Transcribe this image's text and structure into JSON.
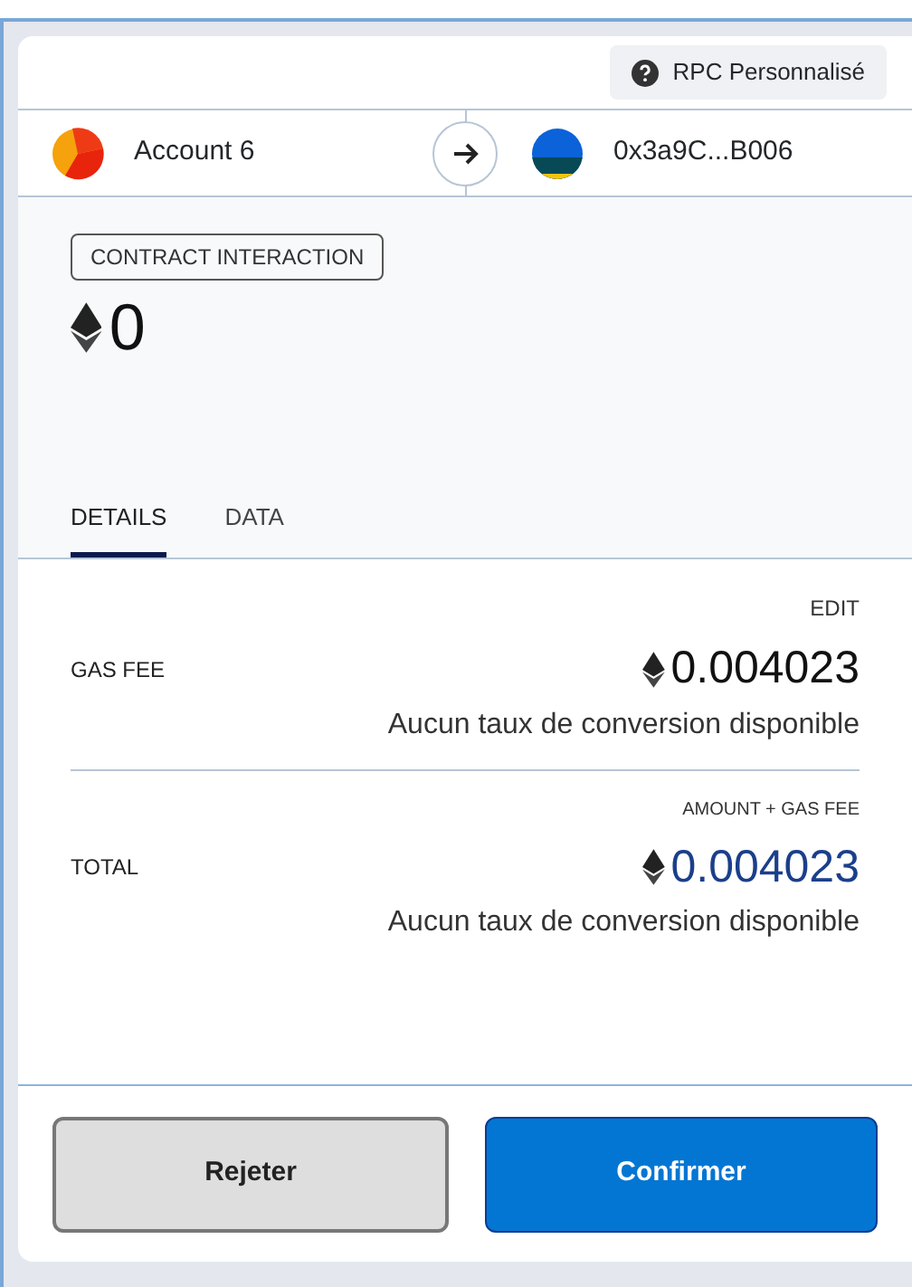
{
  "network": {
    "label": "RPC Personnalisé"
  },
  "from": {
    "name": "Account 6"
  },
  "to": {
    "address": "0x3a9C...B006"
  },
  "action": {
    "label": "CONTRACT INTERACTION"
  },
  "amount": "0",
  "tabs": [
    {
      "label": "DETAILS",
      "selected": true
    },
    {
      "label": "DATA",
      "selected": false
    }
  ],
  "rows": [
    {
      "heading": "EDIT",
      "label": "GAS FEE",
      "value": "0.004023",
      "conversion": "Aucun taux de conversion disponible",
      "highlight": false,
      "heading_link": true
    },
    {
      "heading": "AMOUNT + GAS FEE",
      "label": "TOTAL",
      "value": "0.004023",
      "conversion": "Aucun taux de conversion disponible",
      "highlight": true,
      "heading_link": false
    }
  ],
  "buttons": [
    {
      "label": "Rejeter",
      "kind": "secondary"
    },
    {
      "label": "Confirmer",
      "kind": "primary"
    }
  ]
}
